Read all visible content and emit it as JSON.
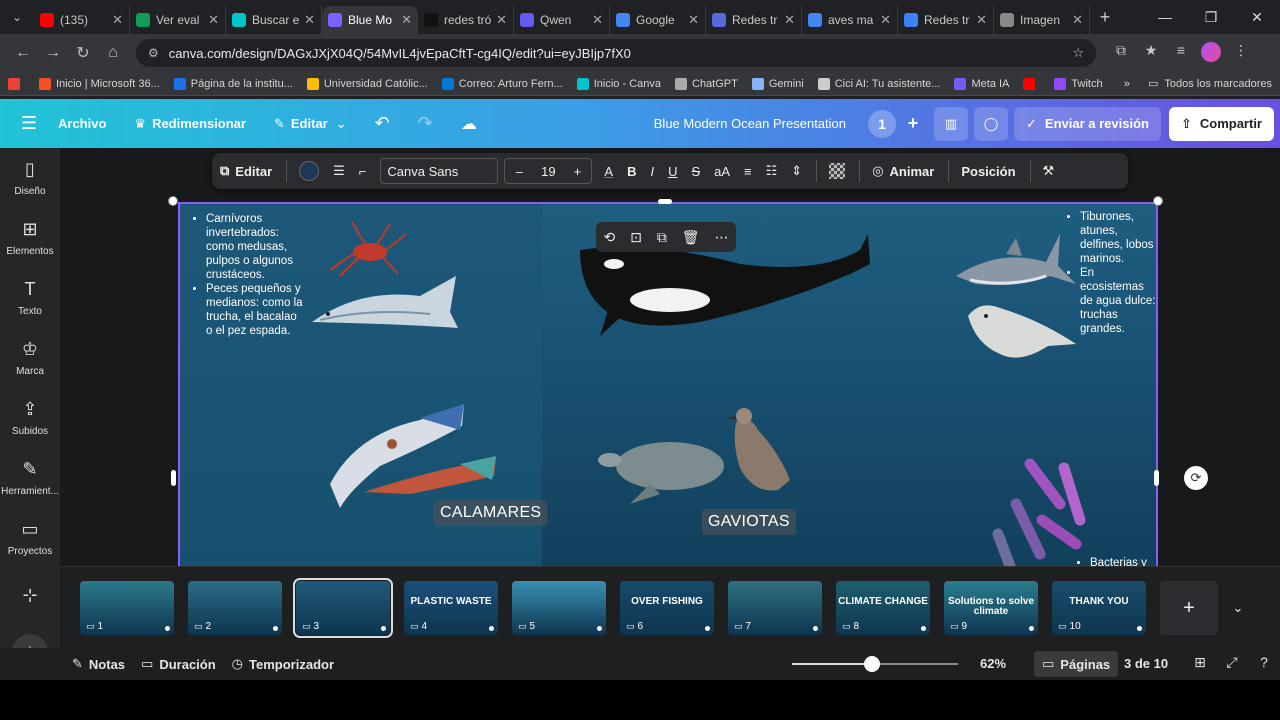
{
  "browser": {
    "tabs": [
      {
        "label": "(135)",
        "color": "#ff0000",
        "icon": "youtube-icon"
      },
      {
        "label": "Ver eval",
        "color": "#0f9d58",
        "icon": "app-icon"
      },
      {
        "label": "Buscar e",
        "color": "#00c4cc",
        "icon": "canva-icon"
      },
      {
        "label": "Blue Mo",
        "color": "#7b61ff",
        "icon": "canva-icon",
        "active": true
      },
      {
        "label": "redes tró",
        "color": "#111111",
        "icon": "app-icon"
      },
      {
        "label": "Qwen",
        "color": "#615ced",
        "icon": "qwen-icon"
      },
      {
        "label": "Google",
        "color": "#4285f4",
        "icon": "gemini-icon"
      },
      {
        "label": "Redes tr",
        "color": "#5a67d8",
        "icon": "app-icon"
      },
      {
        "label": "aves ma",
        "color": "#4285f4",
        "icon": "google-icon"
      },
      {
        "label": "Redes tr",
        "color": "#3b82f6",
        "icon": "app-icon"
      },
      {
        "label": "Imagen",
        "color": "#888888",
        "icon": "app-icon"
      }
    ],
    "url": "canva.com/design/DAGxJXjX04Q/54MvIL4jvEpaCftT-cg4IQ/edit?ui=eyJBIjp7fX0",
    "bookmarks": [
      {
        "label": "",
        "color": "#ea4335"
      },
      {
        "label": "Inicio | Microsoft 36...",
        "color": "#f25022"
      },
      {
        "label": "Página de la institu...",
        "color": "#1a73e8"
      },
      {
        "label": "Universidad Católic...",
        "color": "#fbbc04"
      },
      {
        "label": "Correo: Arturo Fern...",
        "color": "#0078d4"
      },
      {
        "label": "Inicio - Canva",
        "color": "#00c4cc"
      },
      {
        "label": "ChatGPT",
        "color": "#aaaaaa"
      },
      {
        "label": "Gemini",
        "color": "#8ab4f8"
      },
      {
        "label": "Cici AI: Tu asistente...",
        "color": "#cccccc"
      },
      {
        "label": "Meta IA",
        "color": "#6f5cf6"
      },
      {
        "label": "",
        "color": "#ff0000"
      },
      {
        "label": "Twitch",
        "color": "#9146ff"
      }
    ],
    "bookmarks_all": "Todos los marcadores"
  },
  "canva": {
    "menu": {
      "archivo": "Archivo",
      "redimensionar": "Redimensionar",
      "editar": "Editar"
    },
    "title": "Blue Modern Ocean Presentation",
    "collaborators": "1",
    "review": "Enviar a revisión",
    "share": "Compartir"
  },
  "sidebar": [
    {
      "label": "Diseño",
      "icon": "layout-icon",
      "glyph": "▯"
    },
    {
      "label": "Elementos",
      "icon": "elements-icon",
      "glyph": "⊞"
    },
    {
      "label": "Texto",
      "icon": "text-icon",
      "glyph": "T"
    },
    {
      "label": "Marca",
      "icon": "brand-icon",
      "glyph": "♔"
    },
    {
      "label": "Subidos",
      "icon": "upload-icon",
      "glyph": "⇪"
    },
    {
      "label": "Herramient...",
      "icon": "tools-icon",
      "glyph": "✎"
    },
    {
      "label": "Proyectos",
      "icon": "folder-icon",
      "glyph": "▭"
    },
    {
      "label": "",
      "icon": "apps-icon",
      "glyph": "⊹"
    }
  ],
  "editor": {
    "edit": "Editar",
    "font": "Canva Sans",
    "size": "19",
    "animate": "Animar",
    "position": "Posición"
  },
  "slide": {
    "left_text": [
      "Carnívoros invertebrados: como medusas, pulpos o algunos crustáceos.",
      "Peces pequeños y medianos: como la trucha, el bacalao o el pez espada."
    ],
    "right_text": [
      "Tiburones, atunes, delfines, lobos marinos.",
      "En ecosistemas de agua dulce: truchas grandes."
    ],
    "bottom_text": "Bacterias y",
    "label_calamares": "CALAMARES",
    "label_gaviotas": "GAVIOTAS"
  },
  "filmstrip": [
    {
      "num": "1",
      "title": "",
      "bg": "#2c7a8c"
    },
    {
      "num": "2",
      "title": "",
      "bg": "#2b6c86"
    },
    {
      "num": "3",
      "title": "",
      "bg": "#1f5a78",
      "active": true
    },
    {
      "num": "4",
      "title": "PLASTIC WASTE",
      "bg": "#1d4f7a"
    },
    {
      "num": "5",
      "title": "",
      "bg": "#3a8fb0"
    },
    {
      "num": "6",
      "title": "OVER FISHING",
      "bg": "#174a6b"
    },
    {
      "num": "7",
      "title": "",
      "bg": "#2f6f80"
    },
    {
      "num": "8",
      "title": "CLIMATE CHANGE",
      "bg": "#1d5f6e"
    },
    {
      "num": "9",
      "title": "Solutions to solve climate",
      "bg": "#2a7d8f"
    },
    {
      "num": "10",
      "title": "THANK YOU",
      "bg": "#1a4d6a"
    }
  ],
  "bottombar": {
    "notes": "Notas",
    "duration": "Duración",
    "timer": "Temporizador",
    "zoom": "62%",
    "zoom_fraction": 0.48,
    "pages": "Páginas",
    "page_indicator": "3 de 10"
  }
}
